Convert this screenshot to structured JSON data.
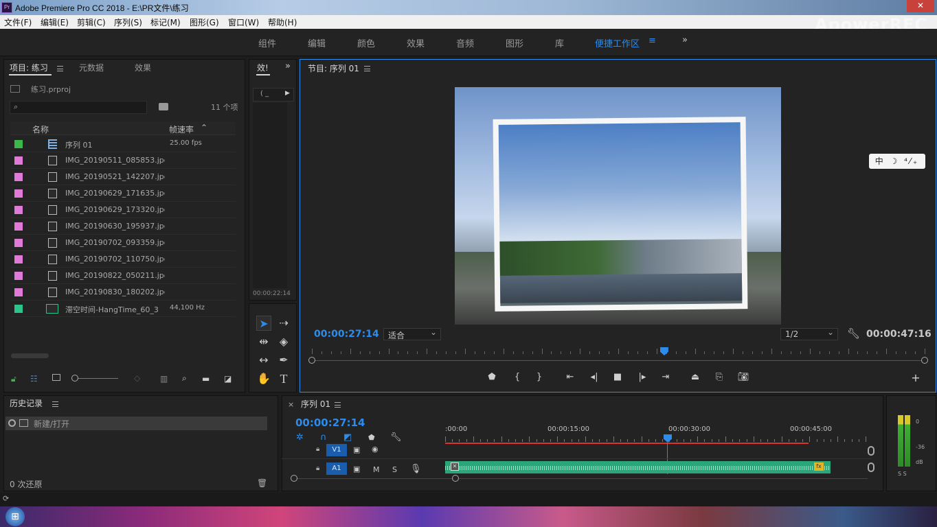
{
  "window": {
    "title": "Adobe Premiere Pro CC 2018 - E:\\PR文件\\练习",
    "app_icon": "Pr",
    "close": "✕"
  },
  "watermark": "ApowerREC",
  "menu": [
    "文件(F)",
    "编辑(E)",
    "剪辑(C)",
    "序列(S)",
    "标记(M)",
    "图形(G)",
    "窗口(W)",
    "帮助(H)"
  ],
  "workspaces": [
    "组件",
    "编辑",
    "颜色",
    "效果",
    "音频",
    "图形",
    "库",
    "便捷工作区"
  ],
  "workspace_active": "便捷工作区",
  "project": {
    "tabs": [
      "项目: 练习",
      "元数据",
      "效果"
    ],
    "file": "练习.prproj",
    "item_count": "11 个项",
    "col_name": "名称",
    "col_rate": "帧速率",
    "items": [
      {
        "name": "序列 01",
        "rate": "25.00 fps",
        "color": "#3cb84a",
        "icon": "sequence-icon"
      },
      {
        "name": "IMG_20190511_085853.jpg",
        "rate": "",
        "color": "#e07ad8",
        "icon": "image-icon"
      },
      {
        "name": "IMG_20190521_142207.jpg",
        "rate": "",
        "color": "#e07ad8",
        "icon": "image-icon"
      },
      {
        "name": "IMG_20190629_171635.jpg",
        "rate": "",
        "color": "#e07ad8",
        "icon": "image-icon"
      },
      {
        "name": "IMG_20190629_173320.jpg",
        "rate": "",
        "color": "#e07ad8",
        "icon": "image-icon"
      },
      {
        "name": "IMG_20190630_195937.jpg",
        "rate": "",
        "color": "#e07ad8",
        "icon": "image-icon"
      },
      {
        "name": "IMG_20190702_093359.jpg",
        "rate": "",
        "color": "#e07ad8",
        "icon": "image-icon"
      },
      {
        "name": "IMG_20190702_110750.jpg",
        "rate": "",
        "color": "#e07ad8",
        "icon": "image-icon"
      },
      {
        "name": "IMG_20190822_050211.jpg",
        "rate": "",
        "color": "#e07ad8",
        "icon": "image-icon"
      },
      {
        "name": "IMG_20190830_180202.jpg",
        "rate": "",
        "color": "#e07ad8",
        "icon": "image-icon"
      },
      {
        "name": "滞空时间-HangTime_60_3",
        "rate": "44,100 Hz",
        "color": "#2bc489",
        "icon": "audio-icon"
      }
    ]
  },
  "effects_panel": {
    "tab": "效!",
    "preview_label": "( _",
    "time": "00:00:22:14"
  },
  "program": {
    "title": "节目: 序列 01",
    "timecode": "00:00:27:14",
    "fit": "适合",
    "resolution": "1/2",
    "duration": "00:00:47:16",
    "ime": "中 ☽ ⁴⁄₊",
    "playhead_fraction": 0.575
  },
  "history": {
    "title": "历史记录",
    "items": [
      "新建/打开"
    ],
    "status": "0 次还原"
  },
  "timeline": {
    "title": "序列 01",
    "timecode": "00:00:27:14",
    "ticks": [
      ":00:00",
      "00:00:15:00",
      "00:00:30:00",
      "00:00:45:00"
    ],
    "tracks": {
      "video": "V1",
      "audio": "A1",
      "mute": "M",
      "solo": "S"
    },
    "audio_fx": "fx"
  },
  "meter": {
    "labels": [
      "0",
      "-36",
      "dB"
    ],
    "solo": "S S"
  },
  "colors": {
    "accent": "#2d8ceb",
    "panel": "#232323",
    "bg": "#1d1d1d",
    "audio_clip": "#2aa67a",
    "work_area": "#e0312b"
  }
}
